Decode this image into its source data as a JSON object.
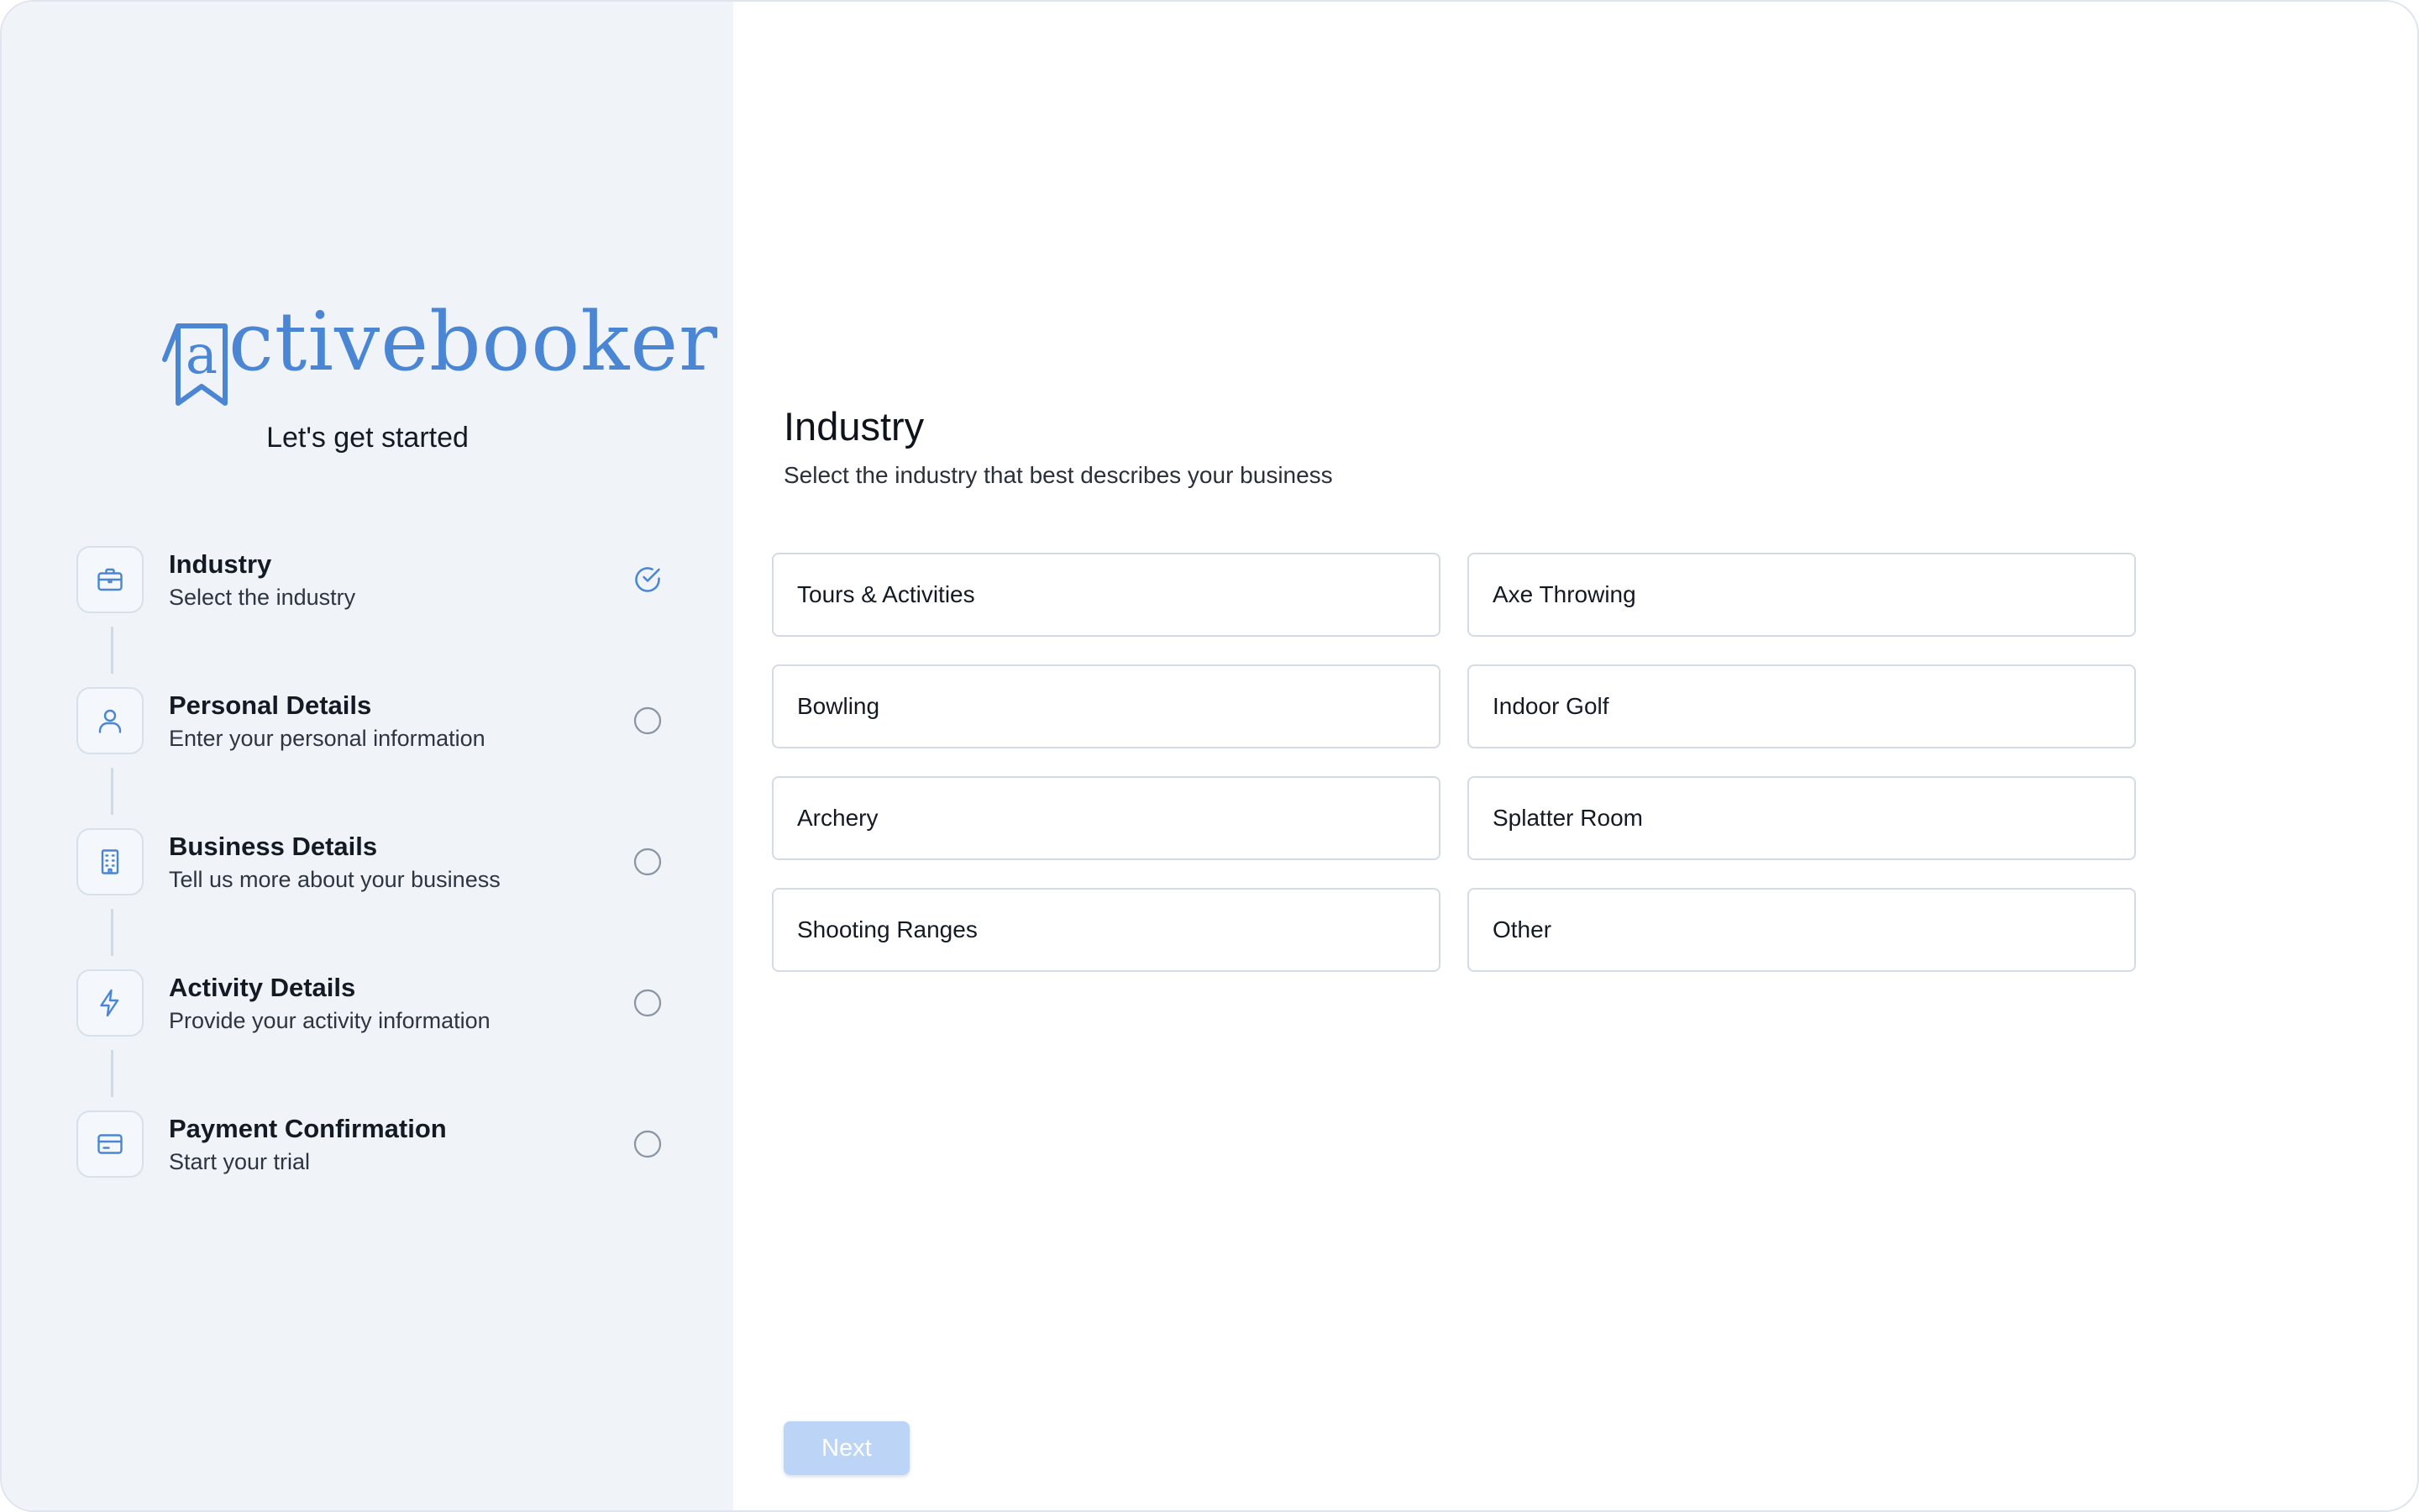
{
  "brand": {
    "name": "activebooker",
    "logo_visible_text": "ctivebooker",
    "color": "#4a86d4"
  },
  "sidebar": {
    "tagline": "Let's get started",
    "steps": [
      {
        "title": "Industry",
        "subtitle": "Select the industry",
        "icon": "briefcase-icon",
        "status": "complete"
      },
      {
        "title": "Personal Details",
        "subtitle": "Enter your personal information",
        "icon": "user-icon",
        "status": "pending"
      },
      {
        "title": "Business Details",
        "subtitle": "Tell us more about your business",
        "icon": "building-icon",
        "status": "pending"
      },
      {
        "title": "Activity Details",
        "subtitle": "Provide your activity information",
        "icon": "lightning-icon",
        "status": "pending"
      },
      {
        "title": "Payment Confirmation",
        "subtitle": "Start your trial",
        "icon": "credit-card-icon",
        "status": "pending"
      }
    ]
  },
  "main": {
    "title": "Industry",
    "subtitle": "Select the industry that best describes your business",
    "options": [
      "Tours & Activities",
      "Axe Throwing",
      "Bowling",
      "Indoor Golf",
      "Archery",
      "Splatter Room",
      "Shooting Ranges",
      "Other"
    ],
    "next_label": "Next"
  },
  "colors": {
    "sidebar_bg": "#f0f4f9",
    "accent": "#4a86d4",
    "next_disabled": "#bcd5f7"
  }
}
